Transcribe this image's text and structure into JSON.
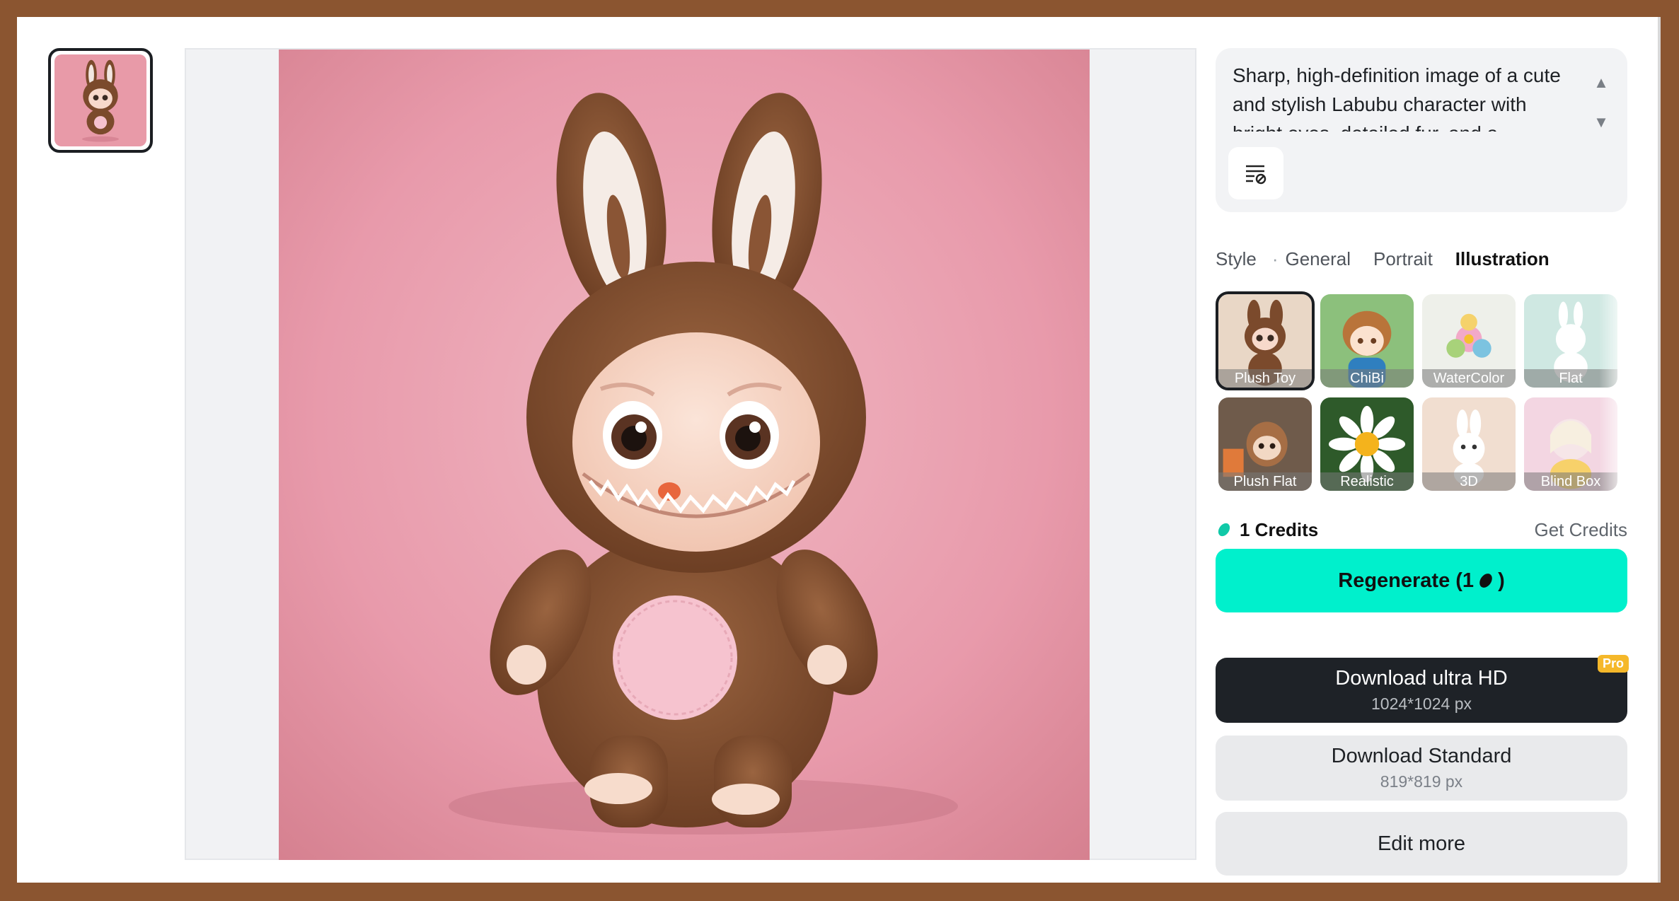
{
  "prompt": {
    "text": "Sharp, high-definition image of a cute and stylish Labubu character with bright eyes, detailed fur, and a"
  },
  "style_section": {
    "label": "Style",
    "separator": "·",
    "tabs": [
      {
        "label": "General",
        "active": false
      },
      {
        "label": "Portrait",
        "active": false
      },
      {
        "label": "Illustration",
        "active": true
      }
    ],
    "items": [
      {
        "label": "Plush Toy",
        "selected": true
      },
      {
        "label": "ChiBi",
        "selected": false
      },
      {
        "label": "WaterColor",
        "selected": false
      },
      {
        "label": "Flat",
        "selected": false
      },
      {
        "label": "Plush Flat",
        "selected": false
      },
      {
        "label": "Realistic",
        "selected": false
      },
      {
        "label": "3D",
        "selected": false
      },
      {
        "label": "Blind Box",
        "selected": false
      }
    ]
  },
  "credits": {
    "amount_label": "1 Credits",
    "get_label": "Get Credits"
  },
  "buttons": {
    "regenerate": "Regenerate (1",
    "regenerate_suffix": ")",
    "download_hd": "Download ultra HD",
    "download_hd_size": "1024*1024 px",
    "pro_badge": "Pro",
    "download_standard": "Download Standard",
    "download_standard_size": "819*819 px",
    "edit_more": "Edit more"
  },
  "colors": {
    "accent": "#00f0cc",
    "dark_button": "#1e2227",
    "pro_badge": "#f5b82a",
    "frame": "#8b5530"
  }
}
